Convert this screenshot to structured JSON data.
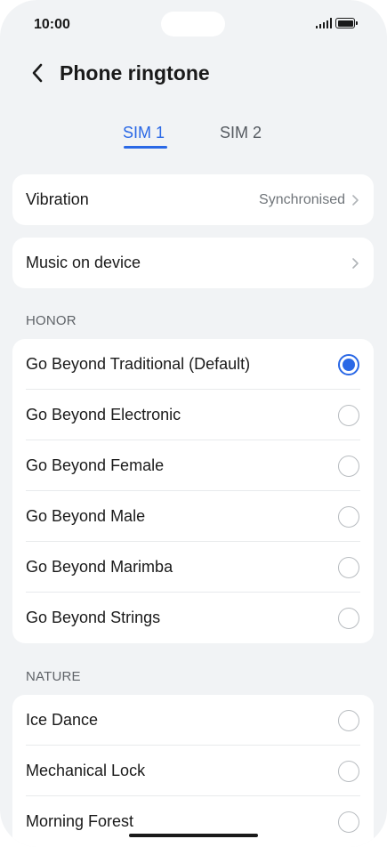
{
  "status_bar": {
    "time": "10:00"
  },
  "header": {
    "title": "Phone ringtone"
  },
  "tabs": [
    {
      "label": "SIM 1",
      "selected": true
    },
    {
      "label": "SIM 2",
      "selected": false
    }
  ],
  "vibration": {
    "label": "Vibration",
    "value": "Synchronised"
  },
  "music_on_device": {
    "label": "Music on device"
  },
  "sections": [
    {
      "title": "HONOR",
      "items": [
        {
          "label": "Go Beyond Traditional (Default)",
          "selected": true
        },
        {
          "label": "Go Beyond Electronic",
          "selected": false
        },
        {
          "label": "Go Beyond Female",
          "selected": false
        },
        {
          "label": "Go Beyond Male",
          "selected": false
        },
        {
          "label": "Go Beyond Marimba",
          "selected": false
        },
        {
          "label": "Go Beyond Strings",
          "selected": false
        }
      ]
    },
    {
      "title": "NATURE",
      "items": [
        {
          "label": "Ice Dance",
          "selected": false
        },
        {
          "label": "Mechanical Lock",
          "selected": false
        },
        {
          "label": "Morning Forest",
          "selected": false
        }
      ]
    }
  ],
  "colors": {
    "accent": "#2a68e6",
    "background": "#f1f3f5",
    "card": "#ffffff"
  }
}
